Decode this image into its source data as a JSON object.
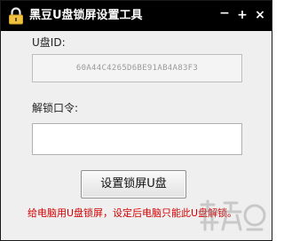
{
  "window": {
    "title": "黑豆U盘锁屏设置工具",
    "min_symbol": "−",
    "max_symbol": "+",
    "close_symbol": "×"
  },
  "form": {
    "usb_id_label": "U盘ID:",
    "usb_id_value": "60A44C4265D6BE91AB4A83F3",
    "unlock_code_label": "解锁口令:",
    "unlock_code_value": ""
  },
  "actions": {
    "set_button_label": "设置锁屏U盘"
  },
  "hint": {
    "text": "给电脑用U盘锁屏，设定后电脑只能此U盘解锁。"
  },
  "colors": {
    "titlebar": "#000000",
    "window_bg": "#efefef",
    "hint": "#d40000"
  },
  "icons": {
    "app": "lock-icon",
    "watermark": "watermark-logo"
  }
}
